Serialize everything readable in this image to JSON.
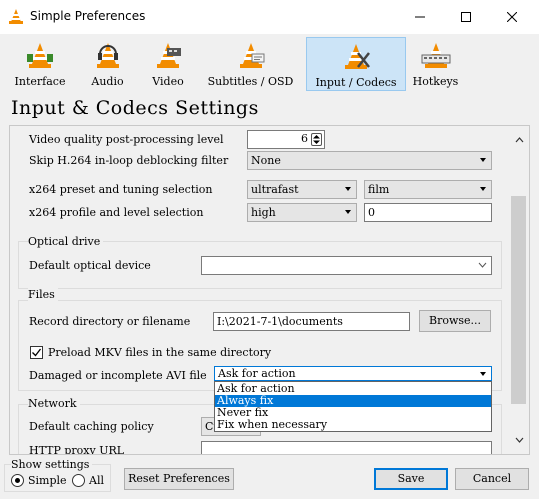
{
  "window": {
    "title": "Simple Preferences"
  },
  "toolbar": {
    "items": [
      {
        "label": "Interface",
        "icon": "interface-cone-icon"
      },
      {
        "label": "Audio",
        "icon": "audio-cone-icon"
      },
      {
        "label": "Video",
        "icon": "video-cone-icon"
      },
      {
        "label": "Subtitles / OSD",
        "icon": "subtitles-cone-icon"
      },
      {
        "label": "Input / Codecs",
        "icon": "input-codecs-cone-icon",
        "active": true
      },
      {
        "label": "Hotkeys",
        "icon": "hotkeys-cone-icon"
      }
    ]
  },
  "page_title": "Input & Codecs Settings",
  "codecs": {
    "pp_label": "Video quality post-processing level",
    "pp_value": "6",
    "skip_label": "Skip H.264 in-loop deblocking filter",
    "skip_value": "None",
    "preset_label": "x264 preset and tuning selection",
    "preset_value": "ultrafast",
    "tune_value": "film",
    "profile_label": "x264 profile and level selection",
    "profile_value": "high",
    "level_value": "0"
  },
  "optical": {
    "title": "Optical drive",
    "device_label": "Default optical device",
    "device_value": ""
  },
  "files": {
    "title": "Files",
    "record_label": "Record directory or filename",
    "record_value": "I:\\2021-7-1\\documents",
    "browse_label": "Browse...",
    "preload_label": "Preload MKV files in the same directory",
    "preload_checked": true,
    "avi_label": "Damaged or incomplete AVI file",
    "avi_value": "Ask for action",
    "avi_options": [
      "Ask for action",
      "Always fix",
      "Never fix",
      "Fix when necessary"
    ],
    "avi_highlighted": "Always fix"
  },
  "network": {
    "title": "Network",
    "caching_label": "Default caching policy",
    "caching_value": "Cu",
    "proxy_label": "HTTP proxy URL"
  },
  "bottom": {
    "show_settings": "Show settings",
    "simple_label": "Simple",
    "all_label": "All",
    "reset_label": "Reset Preferences",
    "save_label": "Save",
    "cancel_label": "Cancel"
  },
  "colors": {
    "accent": "#0078d7",
    "active_tab": "#cce4f7",
    "vlc_orange": "#f28c00"
  }
}
